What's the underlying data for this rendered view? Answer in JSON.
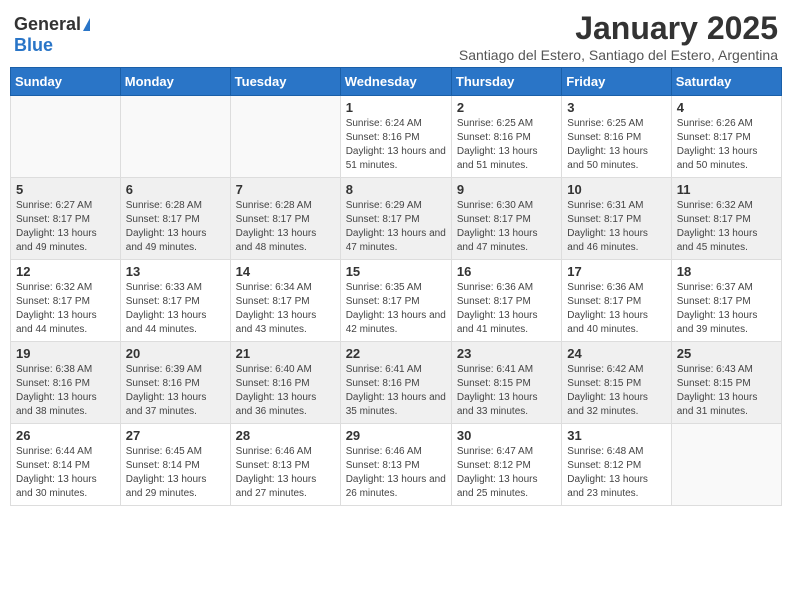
{
  "header": {
    "logo_general": "General",
    "logo_blue": "Blue",
    "month_title": "January 2025",
    "location": "Santiago del Estero, Santiago del Estero, Argentina"
  },
  "days_of_week": [
    "Sunday",
    "Monday",
    "Tuesday",
    "Wednesday",
    "Thursday",
    "Friday",
    "Saturday"
  ],
  "weeks": [
    [
      {
        "day": "",
        "info": ""
      },
      {
        "day": "",
        "info": ""
      },
      {
        "day": "",
        "info": ""
      },
      {
        "day": "1",
        "info": "Sunrise: 6:24 AM\nSunset: 8:16 PM\nDaylight: 13 hours and 51 minutes."
      },
      {
        "day": "2",
        "info": "Sunrise: 6:25 AM\nSunset: 8:16 PM\nDaylight: 13 hours and 51 minutes."
      },
      {
        "day": "3",
        "info": "Sunrise: 6:25 AM\nSunset: 8:16 PM\nDaylight: 13 hours and 50 minutes."
      },
      {
        "day": "4",
        "info": "Sunrise: 6:26 AM\nSunset: 8:17 PM\nDaylight: 13 hours and 50 minutes."
      }
    ],
    [
      {
        "day": "5",
        "info": "Sunrise: 6:27 AM\nSunset: 8:17 PM\nDaylight: 13 hours and 49 minutes."
      },
      {
        "day": "6",
        "info": "Sunrise: 6:28 AM\nSunset: 8:17 PM\nDaylight: 13 hours and 49 minutes."
      },
      {
        "day": "7",
        "info": "Sunrise: 6:28 AM\nSunset: 8:17 PM\nDaylight: 13 hours and 48 minutes."
      },
      {
        "day": "8",
        "info": "Sunrise: 6:29 AM\nSunset: 8:17 PM\nDaylight: 13 hours and 47 minutes."
      },
      {
        "day": "9",
        "info": "Sunrise: 6:30 AM\nSunset: 8:17 PM\nDaylight: 13 hours and 47 minutes."
      },
      {
        "day": "10",
        "info": "Sunrise: 6:31 AM\nSunset: 8:17 PM\nDaylight: 13 hours and 46 minutes."
      },
      {
        "day": "11",
        "info": "Sunrise: 6:32 AM\nSunset: 8:17 PM\nDaylight: 13 hours and 45 minutes."
      }
    ],
    [
      {
        "day": "12",
        "info": "Sunrise: 6:32 AM\nSunset: 8:17 PM\nDaylight: 13 hours and 44 minutes."
      },
      {
        "day": "13",
        "info": "Sunrise: 6:33 AM\nSunset: 8:17 PM\nDaylight: 13 hours and 44 minutes."
      },
      {
        "day": "14",
        "info": "Sunrise: 6:34 AM\nSunset: 8:17 PM\nDaylight: 13 hours and 43 minutes."
      },
      {
        "day": "15",
        "info": "Sunrise: 6:35 AM\nSunset: 8:17 PM\nDaylight: 13 hours and 42 minutes."
      },
      {
        "day": "16",
        "info": "Sunrise: 6:36 AM\nSunset: 8:17 PM\nDaylight: 13 hours and 41 minutes."
      },
      {
        "day": "17",
        "info": "Sunrise: 6:36 AM\nSunset: 8:17 PM\nDaylight: 13 hours and 40 minutes."
      },
      {
        "day": "18",
        "info": "Sunrise: 6:37 AM\nSunset: 8:17 PM\nDaylight: 13 hours and 39 minutes."
      }
    ],
    [
      {
        "day": "19",
        "info": "Sunrise: 6:38 AM\nSunset: 8:16 PM\nDaylight: 13 hours and 38 minutes."
      },
      {
        "day": "20",
        "info": "Sunrise: 6:39 AM\nSunset: 8:16 PM\nDaylight: 13 hours and 37 minutes."
      },
      {
        "day": "21",
        "info": "Sunrise: 6:40 AM\nSunset: 8:16 PM\nDaylight: 13 hours and 36 minutes."
      },
      {
        "day": "22",
        "info": "Sunrise: 6:41 AM\nSunset: 8:16 PM\nDaylight: 13 hours and 35 minutes."
      },
      {
        "day": "23",
        "info": "Sunrise: 6:41 AM\nSunset: 8:15 PM\nDaylight: 13 hours and 33 minutes."
      },
      {
        "day": "24",
        "info": "Sunrise: 6:42 AM\nSunset: 8:15 PM\nDaylight: 13 hours and 32 minutes."
      },
      {
        "day": "25",
        "info": "Sunrise: 6:43 AM\nSunset: 8:15 PM\nDaylight: 13 hours and 31 minutes."
      }
    ],
    [
      {
        "day": "26",
        "info": "Sunrise: 6:44 AM\nSunset: 8:14 PM\nDaylight: 13 hours and 30 minutes."
      },
      {
        "day": "27",
        "info": "Sunrise: 6:45 AM\nSunset: 8:14 PM\nDaylight: 13 hours and 29 minutes."
      },
      {
        "day": "28",
        "info": "Sunrise: 6:46 AM\nSunset: 8:13 PM\nDaylight: 13 hours and 27 minutes."
      },
      {
        "day": "29",
        "info": "Sunrise: 6:46 AM\nSunset: 8:13 PM\nDaylight: 13 hours and 26 minutes."
      },
      {
        "day": "30",
        "info": "Sunrise: 6:47 AM\nSunset: 8:12 PM\nDaylight: 13 hours and 25 minutes."
      },
      {
        "day": "31",
        "info": "Sunrise: 6:48 AM\nSunset: 8:12 PM\nDaylight: 13 hours and 23 minutes."
      },
      {
        "day": "",
        "info": ""
      }
    ]
  ]
}
